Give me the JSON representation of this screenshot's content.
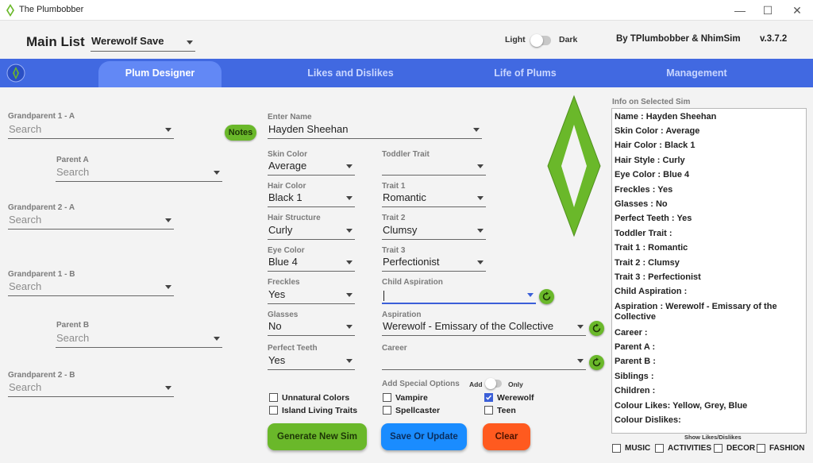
{
  "window": {
    "title": "The Plumbobber",
    "minimize": "—",
    "maximize": "☐",
    "close": "✕"
  },
  "header": {
    "main_list_label": "Main List",
    "save_name": "Werewolf Save",
    "theme_light": "Light",
    "theme_dark": "Dark",
    "credits": "By TPlumbobber & NhimSim",
    "version": "v.3.7.2"
  },
  "nav": {
    "tabs": [
      {
        "label": "Plum Designer",
        "active": true
      },
      {
        "label": "Likes and Dislikes",
        "active": false
      },
      {
        "label": "Life of Plums",
        "active": false
      },
      {
        "label": "Management",
        "active": false
      }
    ]
  },
  "family_tree": {
    "gp1a": {
      "label": "Grandparent 1 - A",
      "placeholder": "Search"
    },
    "parent_a": {
      "label": "Parent A",
      "placeholder": "Search"
    },
    "gp2a": {
      "label": "Grandparent 2 - A",
      "placeholder": "Search"
    },
    "gp1b": {
      "label": "Grandparent 1 - B",
      "placeholder": "Search"
    },
    "parent_b": {
      "label": "Parent B",
      "placeholder": "Search"
    },
    "gp2b": {
      "label": "Grandparent 2 - B",
      "placeholder": "Search"
    },
    "notes_label": "Notes"
  },
  "designer": {
    "name": {
      "label": "Enter Name",
      "value": "Hayden Sheehan"
    },
    "skin_color": {
      "label": "Skin Color",
      "value": "Average"
    },
    "hair_color": {
      "label": "Hair Color",
      "value": "Black 1"
    },
    "hair_structure": {
      "label": "Hair Structure",
      "value": "Curly"
    },
    "eye_color": {
      "label": "Eye Color",
      "value": "Blue 4"
    },
    "freckles": {
      "label": "Freckles",
      "value": "Yes"
    },
    "glasses": {
      "label": "Glasses",
      "value": "No"
    },
    "perfect_teeth": {
      "label": "Perfect Teeth",
      "value": "Yes"
    },
    "toddler_trait": {
      "label": "Toddler Trait",
      "value": ""
    },
    "trait1": {
      "label": "Trait 1",
      "value": "Romantic"
    },
    "trait2": {
      "label": "Trait 2",
      "value": "Clumsy"
    },
    "trait3": {
      "label": "Trait 3",
      "value": "Perfectionist"
    },
    "child_aspiration": {
      "label": "Child Aspiration",
      "value": ""
    },
    "aspiration": {
      "label": "Aspiration",
      "value": "Werewolf - Emissary of the Collective"
    },
    "career": {
      "label": "Career",
      "value": ""
    },
    "special_options_label": "Add Special Options",
    "add_label": "Add",
    "only_label": "Only",
    "checkboxes": {
      "unnatural_colors": {
        "label": "Unnatural Colors",
        "checked": false
      },
      "island_living": {
        "label": "Island Living Traits",
        "checked": false
      },
      "vampire": {
        "label": "Vampire",
        "checked": false
      },
      "spellcaster": {
        "label": "Spellcaster",
        "checked": false
      },
      "werewolf": {
        "label": "Werewolf",
        "checked": true
      },
      "teen": {
        "label": "Teen",
        "checked": false
      }
    },
    "buttons": {
      "generate": "Generate New Sim",
      "save": "Save Or Update",
      "clear": "Clear"
    }
  },
  "info_panel": {
    "title": "Info on Selected Sim",
    "lines": [
      "Name : Hayden Sheehan",
      "Skin Color : Average",
      "Hair Color : Black 1",
      "Hair Style : Curly",
      "Eye Color : Blue 4",
      "Freckles : Yes",
      "Glasses : No",
      "Perfect Teeth : Yes",
      "Toddler Trait :",
      "Trait 1 : Romantic",
      "Trait 2 : Clumsy",
      "Trait 3 : Perfectionist",
      "Child Aspiration :",
      "Aspiration : Werewolf - Emissary of the Collective",
      "Career :",
      "Parent A :",
      "Parent B :",
      "Siblings :",
      "Children :",
      "Colour Likes: Yellow, Grey, Blue",
      "Colour Dislikes:"
    ],
    "show_likes_label": "Show Likes/Dislikes",
    "filters": [
      {
        "label": "MUSIC",
        "checked": false
      },
      {
        "label": "ACTIVITIES",
        "checked": false
      },
      {
        "label": "DECOR",
        "checked": false
      },
      {
        "label": "FASHION",
        "checked": false
      }
    ]
  },
  "colors": {
    "nav_bg": "#4169e1",
    "nav_active": "#6288f5",
    "plumbob_green": "#6ab82a",
    "save_button": "#1a8cff",
    "clear_button": "#ff5a1f",
    "focus_underline": "#3b5fd8"
  }
}
